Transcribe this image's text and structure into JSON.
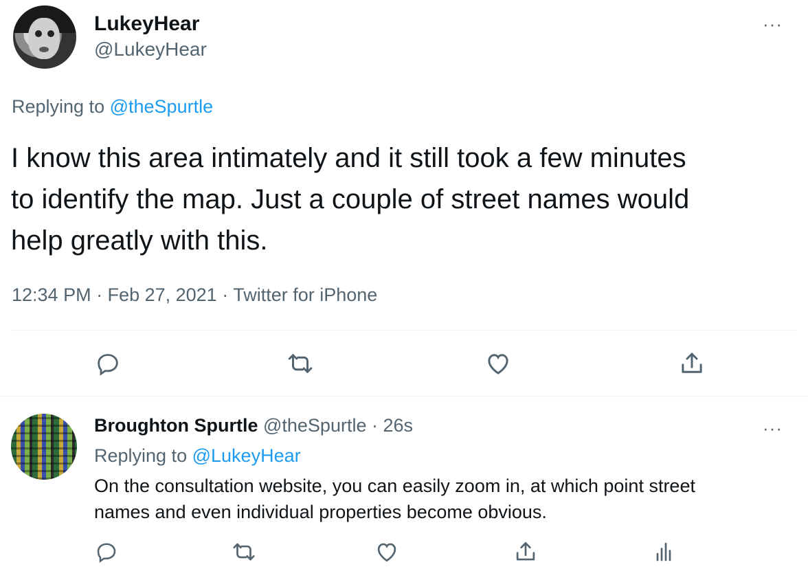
{
  "main_tweet": {
    "author": {
      "display_name": "LukeyHear",
      "handle": "@LukeyHear"
    },
    "replying_prefix": "Replying to",
    "replying_to": "@theSpurtle",
    "text_lines": [
      "I know this area intimately and it still took a few minutes",
      "to identify the map. Just a couple of street names would",
      "help greatly with this."
    ],
    "meta": "12:34 PM · Feb 27, 2021 · Twitter for iPhone",
    "more": "···"
  },
  "reply_tweet": {
    "author": {
      "display_name": "Broughton Spurtle",
      "handle": "@theSpurtle",
      "time": "· 26s"
    },
    "replying_prefix": "Replying to",
    "replying_to": "@LukeyHear",
    "text_lines": [
      "On the consultation website, you can easily zoom in, at which point street",
      "names and even individual properties become obvious."
    ],
    "more": "···"
  },
  "icons": {
    "reply": "reply-icon",
    "retweet": "retweet-icon",
    "like": "heart-icon",
    "share": "share-icon",
    "analytics": "analytics-icon"
  },
  "colors": {
    "accent": "#1d9bf0",
    "muted": "#536471",
    "text": "#0f1419",
    "divider": "#eff3f4"
  }
}
